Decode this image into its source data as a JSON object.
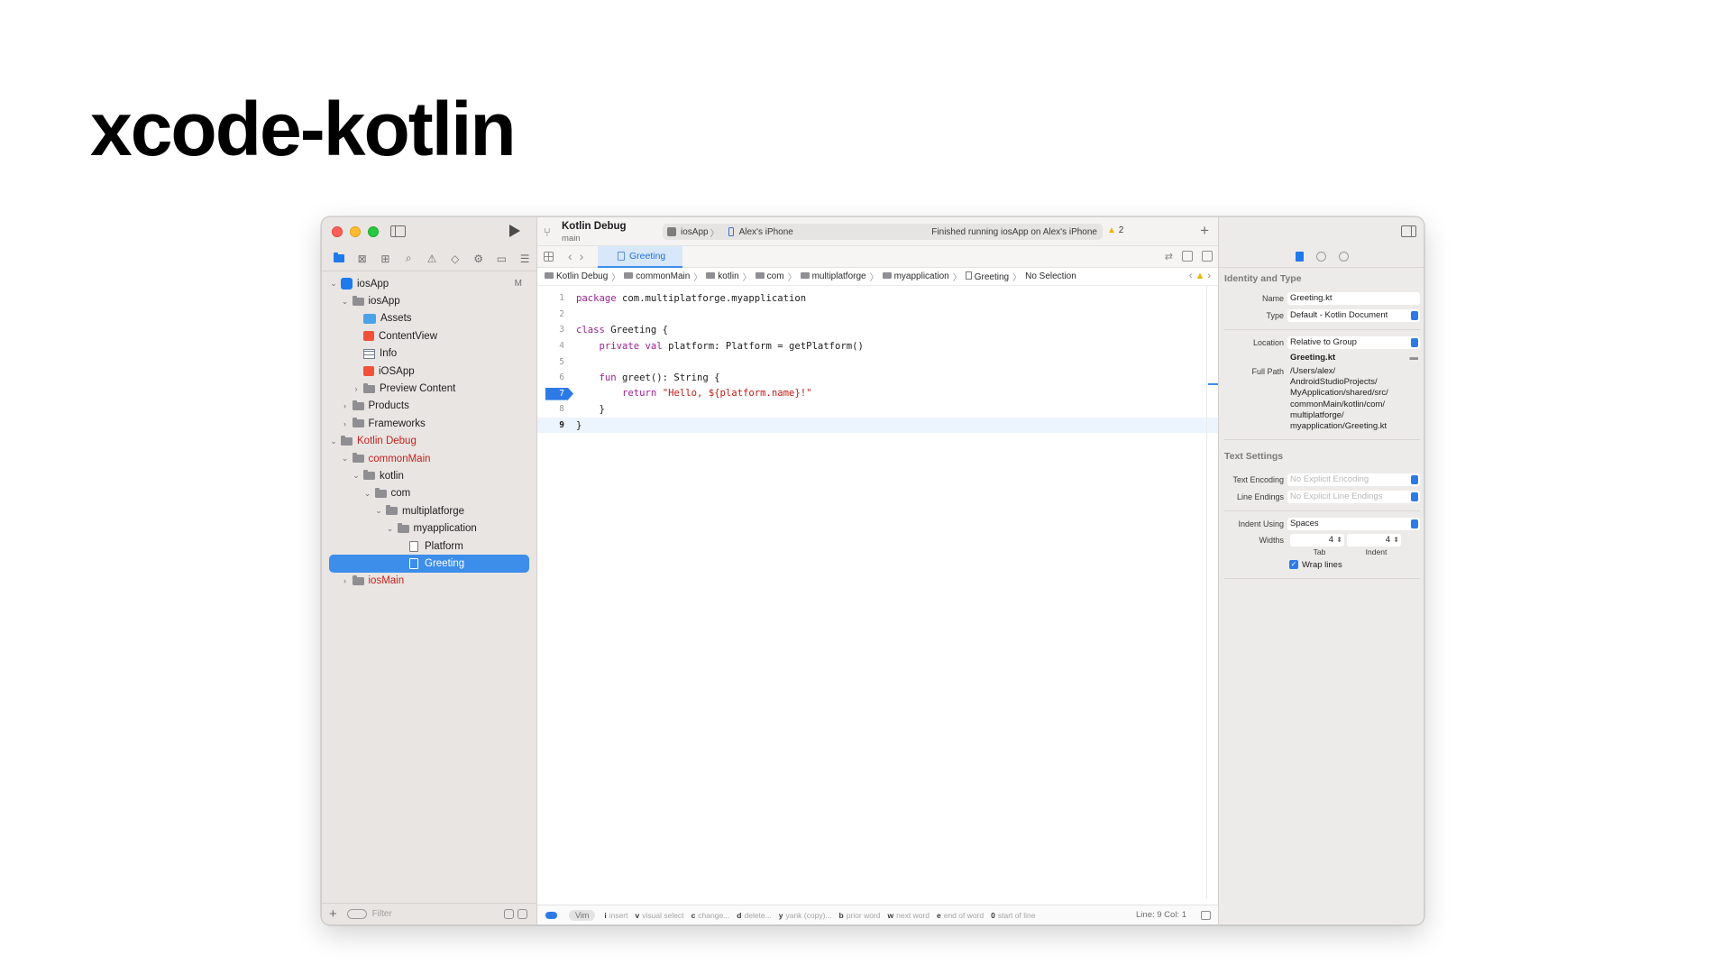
{
  "slide": {
    "title": "xcode-kotlin"
  },
  "toolbar": {
    "scheme_name": "Kotlin Debug",
    "branch": "main",
    "target_app": "iosApp",
    "device": "Alex's iPhone",
    "status": "Finished running iosApp on Alex's iPhone",
    "warning_count": "2",
    "add_label": "+",
    "separator": "〉"
  },
  "navigator": {
    "tree": [
      {
        "label": "iosApp",
        "depth": 0,
        "icon": "project-icon",
        "disclosure": "v",
        "badge": "M"
      },
      {
        "label": "iosApp",
        "depth": 1,
        "icon": "folder-icon",
        "disclosure": "v"
      },
      {
        "label": "Assets",
        "depth": 2,
        "icon": "assets-icon"
      },
      {
        "label": "ContentView",
        "depth": 2,
        "icon": "swift-file-icon"
      },
      {
        "label": "Info",
        "depth": 2,
        "icon": "plist-icon"
      },
      {
        "label": "iOSApp",
        "depth": 2,
        "icon": "swift-file-icon"
      },
      {
        "label": "Preview Content",
        "depth": 2,
        "icon": "folder-icon",
        "disclosure": ">"
      },
      {
        "label": "Products",
        "depth": 1,
        "icon": "folder-icon",
        "disclosure": ">"
      },
      {
        "label": "Frameworks",
        "depth": 1,
        "icon": "folder-icon",
        "disclosure": ">"
      },
      {
        "label": "Kotlin Debug",
        "depth": 0,
        "icon": "folder-icon",
        "disclosure": "v",
        "red": true
      },
      {
        "label": "commonMain",
        "depth": 1,
        "icon": "folder-icon",
        "disclosure": "v",
        "red": true
      },
      {
        "label": "kotlin",
        "depth": 2,
        "icon": "folder-icon",
        "disclosure": "v"
      },
      {
        "label": "com",
        "depth": 3,
        "icon": "folder-icon",
        "disclosure": "v"
      },
      {
        "label": "multiplatforge",
        "depth": 4,
        "icon": "folder-icon",
        "disclosure": "v"
      },
      {
        "label": "myapplication",
        "depth": 5,
        "icon": "folder-icon",
        "disclosure": "v"
      },
      {
        "label": "Platform",
        "depth": 6,
        "icon": "kotlin-file-icon"
      },
      {
        "label": "Greeting",
        "depth": 6,
        "icon": "kotlin-file-icon",
        "selected": true
      },
      {
        "label": "iosMain",
        "depth": 1,
        "icon": "folder-icon",
        "disclosure": ">",
        "red": true
      }
    ],
    "filter_placeholder": "Filter",
    "add_label": "+"
  },
  "editor": {
    "tab_label": "Greeting",
    "breadcrumb": [
      "Kotlin Debug",
      "commonMain",
      "kotlin",
      "com",
      "multiplatforge",
      "myapplication",
      "Greeting",
      "No Selection"
    ],
    "code_lines": [
      {
        "n": "1",
        "html": "<span class=\"kw\">package</span> com.multiplatforge.myapplication"
      },
      {
        "n": "2",
        "html": ""
      },
      {
        "n": "3",
        "html": "<span class=\"kw\">class</span> Greeting {"
      },
      {
        "n": "4",
        "html": "    <span class=\"kw\">private val</span> platform: Platform = getPlatform()"
      },
      {
        "n": "5",
        "html": ""
      },
      {
        "n": "6",
        "html": "    <span class=\"kw\">fun</span> greet(): String {"
      },
      {
        "n": "7",
        "html": "        <span class=\"kw\">return</span> <span class=\"str\">\"Hello, ${platform.name}!\"</span>",
        "breakpoint": true
      },
      {
        "n": "8",
        "html": "    }"
      },
      {
        "n": "9",
        "html": "}",
        "current": true
      }
    ],
    "status": {
      "mode": "Vim",
      "hints": [
        {
          "key": "i",
          "text": "insert"
        },
        {
          "key": "v",
          "text": "visual select"
        },
        {
          "key": "c",
          "text": "change..."
        },
        {
          "key": "d",
          "text": "delete..."
        },
        {
          "key": "y",
          "text": "yank (copy)..."
        },
        {
          "key": "b",
          "text": "prior word"
        },
        {
          "key": "w",
          "text": "next word"
        },
        {
          "key": "e",
          "text": "end of word"
        },
        {
          "key": "0",
          "text": "start of line"
        }
      ],
      "line_col": "Line: 9  Col: 1"
    }
  },
  "inspector": {
    "identity_heading": "Identity and Type",
    "name_label": "Name",
    "name_value": "Greeting.kt",
    "type_label": "Type",
    "type_value": "Default - Kotlin Document",
    "location_label": "Location",
    "location_value": "Relative to Group",
    "location_file": "Greeting.kt",
    "full_path_label": "Full Path",
    "full_path_lines": [
      "/Users/alex/",
      "AndroidStudioProjects/",
      "MyApplication/shared/src/",
      "commonMain/kotlin/com/",
      "multiplatforge/",
      "myapplication/Greeting.kt"
    ],
    "text_heading": "Text Settings",
    "encoding_label": "Text Encoding",
    "encoding_value": "No Explicit Encoding",
    "endings_label": "Line Endings",
    "endings_value": "No Explicit Line Endings",
    "indent_label": "Indent Using",
    "indent_value": "Spaces",
    "widths_label": "Widths",
    "tab_width": "4",
    "indent_width": "4",
    "tab_sublabel": "Tab",
    "indent_sublabel": "Indent",
    "wrap_label": "Wrap lines",
    "wrap_checked": true
  }
}
